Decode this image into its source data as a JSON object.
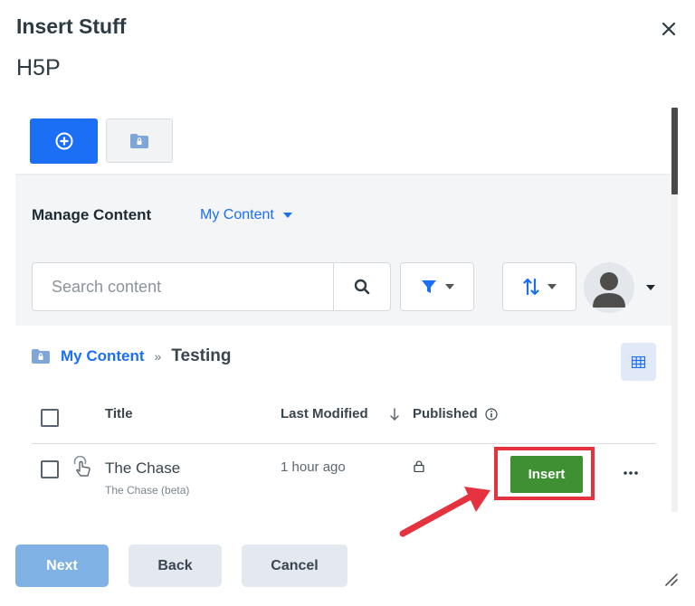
{
  "dialog": {
    "title": "Insert Stuff",
    "tool_title": "H5P"
  },
  "manage": {
    "label": "Manage Content",
    "selected_view": "My Content"
  },
  "search": {
    "placeholder": "Search content"
  },
  "breadcrumb": {
    "root": "My Content",
    "separator": "»",
    "current": "Testing"
  },
  "table": {
    "headers": {
      "title": "Title",
      "last_modified": "Last Modified",
      "published": "Published"
    },
    "rows": [
      {
        "title": "The Chase",
        "subtitle": "The Chase (beta)",
        "last_modified": "1 hour ago",
        "action_label": "Insert"
      }
    ]
  },
  "footer": {
    "next_label": "Next",
    "back_label": "Back",
    "cancel_label": "Cancel"
  },
  "icons": {
    "close": "close-icon",
    "create": "plus-circle-icon",
    "folder": "folder-lock-icon",
    "search": "search-icon",
    "filter": "filter-icon",
    "sort": "sort-icon",
    "avatar": "user-avatar-icon",
    "grid": "grid-view-icon",
    "info": "info-icon",
    "lock": "lock-icon",
    "content_type": "touch-icon",
    "more": "more-dots-icon"
  },
  "colors": {
    "primary": "#1a6ff4",
    "insert": "#3f8f33",
    "highlight": "#e5323f",
    "next_disabled": "#7fb1e4"
  }
}
